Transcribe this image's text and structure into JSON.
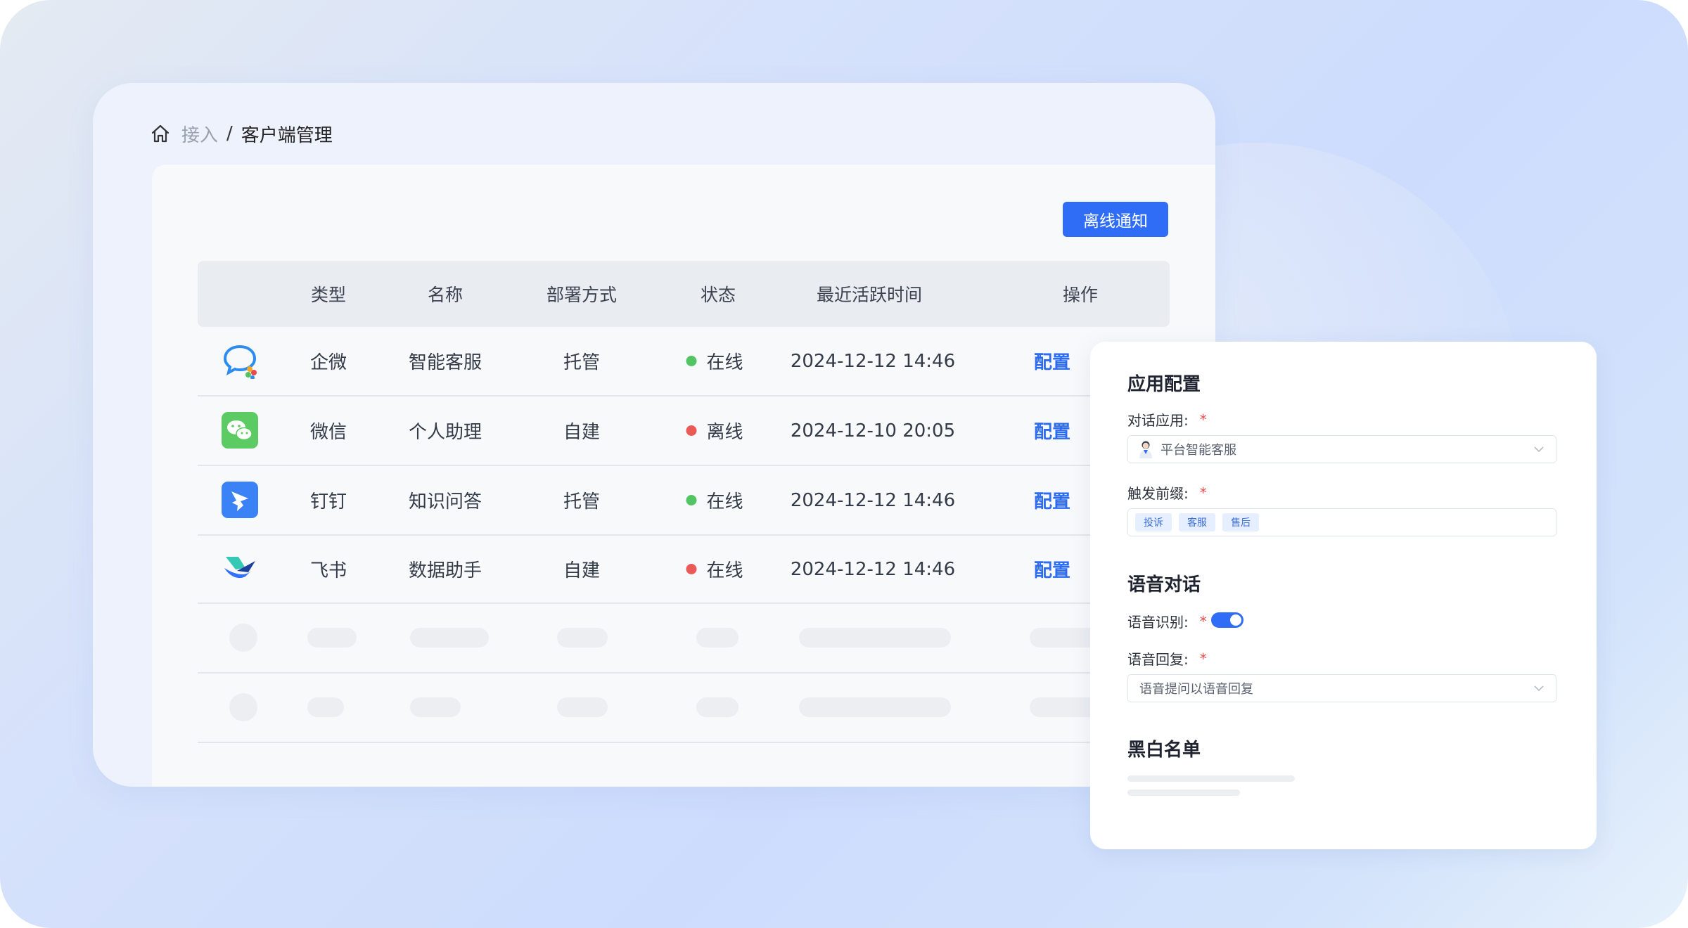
{
  "breadcrumb": {
    "parent": "接入",
    "separator": "/",
    "current": "客户端管理"
  },
  "toolbar": {
    "offline_notice_label": "离线通知"
  },
  "table": {
    "headers": [
      "类型",
      "名称",
      "部署方式",
      "状态",
      "最近活跃时间",
      "操作"
    ],
    "rows": [
      {
        "icon": "wecom-icon",
        "type": "企微",
        "name": "智能客服",
        "deploy": "托管",
        "status": "在线",
        "status_color": "#52c463",
        "time": "2024-12-12 14:46",
        "action": "配置"
      },
      {
        "icon": "wechat-icon",
        "type": "微信",
        "name": "个人助理",
        "deploy": "自建",
        "status": "离线",
        "status_color": "#ea5a57",
        "time": "2024-12-10 20:05",
        "action": "配置"
      },
      {
        "icon": "dingtalk-icon",
        "type": "钉钉",
        "name": "知识问答",
        "deploy": "托管",
        "status": "在线",
        "status_color": "#52c463",
        "time": "2024-12-12 14:46",
        "action": "配置"
      },
      {
        "icon": "feishu-icon",
        "type": "飞书",
        "name": "数据助手",
        "deploy": "自建",
        "status": "在线",
        "status_color": "#ea5a57",
        "time": "2024-12-12 14:46",
        "action": "配置"
      }
    ]
  },
  "panel": {
    "app_config_title": "应用配置",
    "dialog_app_label": "对话应用:",
    "dialog_app_value": "平台智能客服",
    "trigger_prefix_label": "触发前缀:",
    "trigger_tags": [
      "投诉",
      "客服",
      "售后"
    ],
    "voice_title": "语音对话",
    "voice_recognition_label": "语音识别:",
    "voice_recognition_enabled": true,
    "voice_reply_label": "语音回复:",
    "voice_reply_value": "语音提问以语音回复",
    "blacklist_title": "黑白名单",
    "required_mark": "*"
  },
  "colors": {
    "primary": "#2f6df6",
    "online": "#52c463",
    "offline": "#ea5a57",
    "link": "#2d6cf0"
  }
}
